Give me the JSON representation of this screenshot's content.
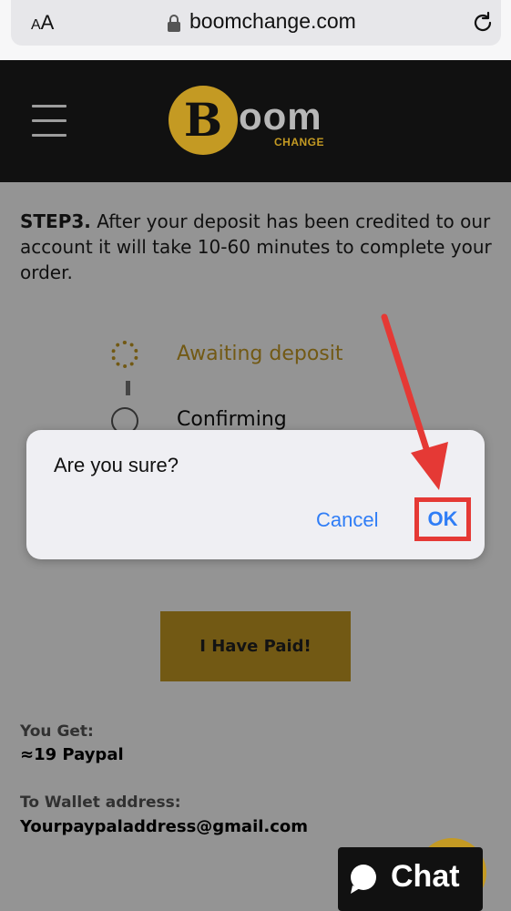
{
  "browser": {
    "text_size_label": "AA",
    "host": "boomchange.com"
  },
  "header": {
    "logo_letter": "B",
    "logo_word": "oom",
    "logo_sub": "CHANGE"
  },
  "step": {
    "label": "STEP3.",
    "text": " After your deposit has been credited to our account it will take 10-60 minutes to complete your order."
  },
  "statuses": [
    {
      "label": "Awaiting deposit",
      "color": "#c49a23",
      "state": "active"
    },
    {
      "label": "Confirming",
      "color": "#555555",
      "state": "pending"
    }
  ],
  "actions": {
    "paid_label": "I Have Paid!"
  },
  "summary": {
    "you_get_label": "You Get:",
    "you_get_value": "≈19 Paypal",
    "wallet_label": "To Wallet address:",
    "wallet_value": "Yourpaypaladdress@gmail.com"
  },
  "dialog": {
    "message": "Are you sure?",
    "cancel_label": "Cancel",
    "ok_label": "OK"
  },
  "chat": {
    "label": "Chat"
  },
  "colors": {
    "brand_gold": "#c49a23",
    "ios_blue": "#2f7df6",
    "highlight_red": "#e53935",
    "header_bg": "#111111"
  }
}
